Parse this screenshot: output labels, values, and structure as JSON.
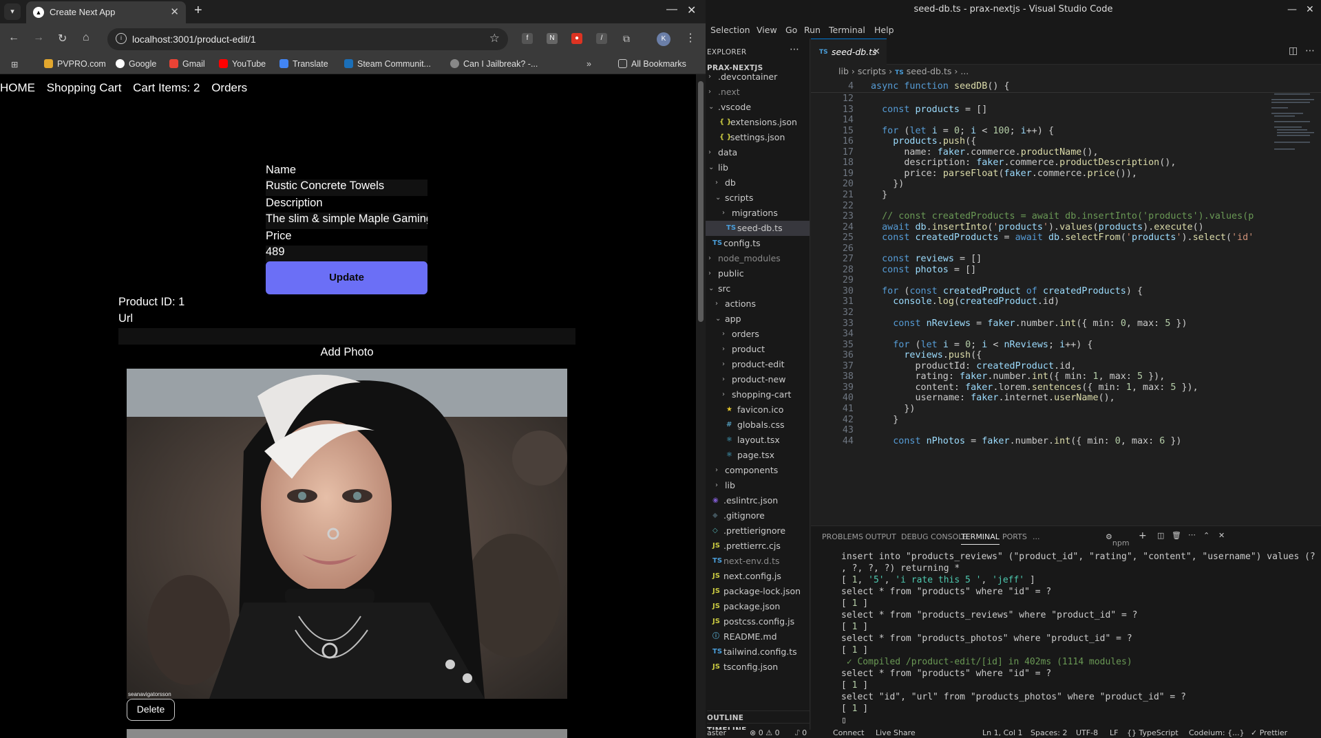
{
  "chrome": {
    "tab_title": "Create Next App",
    "url": "localhost:3001/product-edit/1",
    "bookmarks": [
      "PVPRO.com",
      "Google",
      "Gmail",
      "YouTube",
      "Translate",
      "Steam Communit...",
      "Can I Jailbreak? -..."
    ],
    "all_bookmarks": "All Bookmarks",
    "profile_initial": "K"
  },
  "app": {
    "nav": [
      "HOME",
      "Shopping Cart",
      "Cart Items: 2",
      "Orders"
    ],
    "name_label": "Name",
    "name_value": "Rustic Concrete Towels",
    "description_label": "Description",
    "description_value": "The slim & simple Maple Gaming Keyboard",
    "price_label": "Price",
    "price_value": "489",
    "update_button": "Update",
    "product_id": "Product ID: 1",
    "url_label": "Url",
    "add_photo": "Add Photo",
    "delete_button": "Delete",
    "photo_watermark": "seanavigatorsson"
  },
  "vscode": {
    "title": "seed-db.ts - prax-nextjs - Visual Studio Code",
    "menu": [
      "Selection",
      "View",
      "Go",
      "Run",
      "Terminal",
      "Help"
    ],
    "explorer_title": "EXPLORER",
    "project": "PRAX-NEXTJS",
    "tree": [
      {
        "name": ".devcontainer",
        "type": "folder",
        "depth": 0,
        "open": false
      },
      {
        "name": ".next",
        "type": "folder",
        "depth": 0,
        "open": false,
        "dim": true
      },
      {
        "name": ".vscode",
        "type": "folder",
        "depth": 0,
        "open": true
      },
      {
        "name": "extensions.json",
        "type": "json",
        "depth": 1
      },
      {
        "name": "settings.json",
        "type": "json",
        "depth": 1
      },
      {
        "name": "data",
        "type": "folder",
        "depth": 0,
        "open": false
      },
      {
        "name": "lib",
        "type": "folder",
        "depth": 0,
        "open": true
      },
      {
        "name": "db",
        "type": "folder",
        "depth": 1,
        "open": false
      },
      {
        "name": "scripts",
        "type": "folder",
        "depth": 1,
        "open": true
      },
      {
        "name": "migrations",
        "type": "folder",
        "depth": 2,
        "open": false
      },
      {
        "name": "seed-db.ts",
        "type": "ts",
        "depth": 2,
        "selected": true
      },
      {
        "name": "config.ts",
        "type": "ts",
        "depth": 0
      },
      {
        "name": "node_modules",
        "type": "folder",
        "depth": 0,
        "open": false,
        "dim": true
      },
      {
        "name": "public",
        "type": "folder",
        "depth": 0,
        "open": false
      },
      {
        "name": "src",
        "type": "folder",
        "depth": 0,
        "open": true
      },
      {
        "name": "actions",
        "type": "folder",
        "depth": 1,
        "open": false
      },
      {
        "name": "app",
        "type": "folder",
        "depth": 1,
        "open": true
      },
      {
        "name": "orders",
        "type": "folder",
        "depth": 2,
        "open": false
      },
      {
        "name": "product",
        "type": "folder",
        "depth": 2,
        "open": false
      },
      {
        "name": "product-edit",
        "type": "folder",
        "depth": 2,
        "open": false
      },
      {
        "name": "product-new",
        "type": "folder",
        "depth": 2,
        "open": false
      },
      {
        "name": "shopping-cart",
        "type": "folder",
        "depth": 2,
        "open": false
      },
      {
        "name": "favicon.ico",
        "type": "ico",
        "depth": 2
      },
      {
        "name": "globals.css",
        "type": "css",
        "depth": 2
      },
      {
        "name": "layout.tsx",
        "type": "tsx",
        "depth": 2
      },
      {
        "name": "page.tsx",
        "type": "tsx",
        "depth": 2
      },
      {
        "name": "components",
        "type": "folder",
        "depth": 1,
        "open": false
      },
      {
        "name": "lib",
        "type": "folder",
        "depth": 1,
        "open": false
      },
      {
        "name": ".eslintrc.json",
        "type": "eslint",
        "depth": 0
      },
      {
        "name": ".gitignore",
        "type": "git",
        "depth": 0
      },
      {
        "name": ".prettierignore",
        "type": "prettier",
        "depth": 0
      },
      {
        "name": ".prettierrc.cjs",
        "type": "js",
        "depth": 0
      },
      {
        "name": "next-env.d.ts",
        "type": "ts",
        "depth": 0,
        "dim": true
      },
      {
        "name": "next.config.js",
        "type": "js",
        "depth": 0
      },
      {
        "name": "package-lock.json",
        "type": "js",
        "depth": 0
      },
      {
        "name": "package.json",
        "type": "js",
        "depth": 0
      },
      {
        "name": "postcss.config.js",
        "type": "js",
        "depth": 0
      },
      {
        "name": "README.md",
        "type": "md",
        "depth": 0
      },
      {
        "name": "tailwind.config.ts",
        "type": "ts",
        "depth": 0
      },
      {
        "name": "tsconfig.json",
        "type": "js",
        "depth": 0
      }
    ],
    "outline": "OUTLINE",
    "timeline": "TIMELINE",
    "editor_tab": "seed-db.ts",
    "breadcrumbs": [
      "lib",
      "scripts",
      "seed-db.ts",
      "..."
    ],
    "sticky": {
      "n": "4",
      "code": "async function seedDB() {"
    },
    "code": [
      {
        "n": "12",
        "code": ""
      },
      {
        "n": "13",
        "code": "  const products = []"
      },
      {
        "n": "14",
        "code": ""
      },
      {
        "n": "15",
        "code": "  for (let i = 0; i < 100; i++) {"
      },
      {
        "n": "16",
        "code": "    products.push({"
      },
      {
        "n": "17",
        "code": "      name: faker.commerce.productName(),"
      },
      {
        "n": "18",
        "code": "      description: faker.commerce.productDescription(),"
      },
      {
        "n": "19",
        "code": "      price: parseFloat(faker.commerce.price()),"
      },
      {
        "n": "20",
        "code": "    })"
      },
      {
        "n": "21",
        "code": "  }"
      },
      {
        "n": "22",
        "code": ""
      },
      {
        "n": "23",
        "code": "  // const createdProducts = await db.insertInto('products').values(p"
      },
      {
        "n": "24",
        "code": "  await db.insertInto('products').values(products).execute()"
      },
      {
        "n": "25",
        "code": "  const createdProducts = await db.selectFrom('products').select('id'"
      },
      {
        "n": "26",
        "code": ""
      },
      {
        "n": "27",
        "code": "  const reviews = []"
      },
      {
        "n": "28",
        "code": "  const photos = []"
      },
      {
        "n": "29",
        "code": ""
      },
      {
        "n": "30",
        "code": "  for (const createdProduct of createdProducts) {"
      },
      {
        "n": "31",
        "code": "    console.log(createdProduct.id)"
      },
      {
        "n": "32",
        "code": ""
      },
      {
        "n": "33",
        "code": "    const nReviews = faker.number.int({ min: 0, max: 5 })"
      },
      {
        "n": "34",
        "code": ""
      },
      {
        "n": "35",
        "code": "    for (let i = 0; i < nReviews; i++) {"
      },
      {
        "n": "36",
        "code": "      reviews.push({"
      },
      {
        "n": "37",
        "code": "        productId: createdProduct.id,"
      },
      {
        "n": "38",
        "code": "        rating: faker.number.int({ min: 1, max: 5 }),"
      },
      {
        "n": "39",
        "code": "        content: faker.lorem.sentences({ min: 1, max: 5 }),"
      },
      {
        "n": "40",
        "code": "        username: faker.internet.userName(),"
      },
      {
        "n": "41",
        "code": "      })"
      },
      {
        "n": "42",
        "code": "    }"
      },
      {
        "n": "43",
        "code": ""
      },
      {
        "n": "44",
        "code": "    const nPhotos = faker.number.int({ min: 0, max: 6 })"
      }
    ],
    "panel_tabs": [
      "PROBLEMS",
      "OUTPUT",
      "DEBUG CONSOLE",
      "TERMINAL",
      "PORTS",
      "..."
    ],
    "terminal_shell": "npm",
    "terminal": [
      "insert into \"products_reviews\" (\"product_id\", \"rating\", \"content\", \"username\") values (?",
      ", ?, ?, ?) returning *",
      "[ 1, '5', 'i rate this 5 ', 'jeff' ]",
      "select * from \"products\" where \"id\" = ?",
      "[ 1 ]",
      "select * from \"products_reviews\" where \"product_id\" = ?",
      "[ 1 ]",
      "select * from \"products_photos\" where \"product_id\" = ?",
      "[ 1 ]",
      " ✓ Compiled /product-edit/[id] in 402ms (1114 modules)",
      "select * from \"products\" where \"id\" = ?",
      "[ 1 ]",
      "select \"id\", \"url\" from \"products_photos\" where \"product_id\" = ?",
      "[ 1 ]",
      "▯"
    ],
    "status": [
      "aster",
      "⊗ 0 ⚠ 0",
      "⑀ 0",
      "Connect",
      "Live Share",
      "Ln 1, Col 1",
      "Spaces: 2",
      "UTF-8",
      "LF",
      "{} TypeScript",
      "Codeium: {...}",
      "✓ Prettier"
    ]
  }
}
